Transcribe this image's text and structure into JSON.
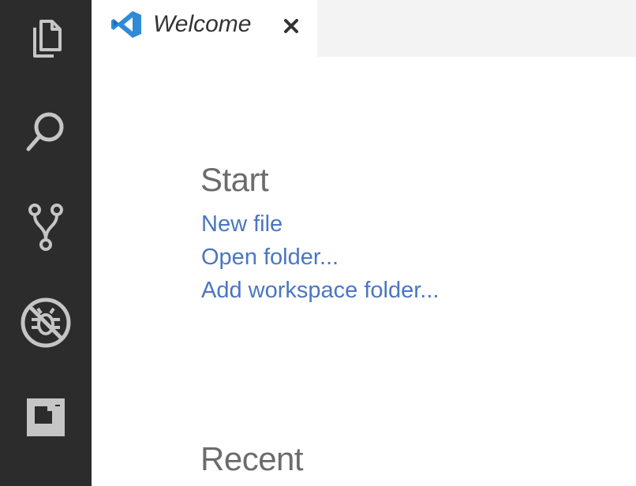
{
  "activity_bar": {
    "items": [
      {
        "icon": "explorer-icon"
      },
      {
        "icon": "search-icon"
      },
      {
        "icon": "source-control-icon"
      },
      {
        "icon": "debug-icon"
      },
      {
        "icon": "extensions-icon"
      }
    ],
    "background": "#2c2c2c",
    "icon_color": "#c5c5c5"
  },
  "tab": {
    "label": "Welcome",
    "logo_icon": "vscode-logo-icon",
    "close_icon": "close-icon"
  },
  "welcome": {
    "start": {
      "heading": "Start",
      "links": [
        "New file",
        "Open folder...",
        "Add workspace folder..."
      ]
    },
    "recent": {
      "heading": "Recent"
    }
  },
  "colors": {
    "link": "#4a76c0",
    "heading": "#6c6c6c",
    "accent": "#2f8ad8"
  }
}
